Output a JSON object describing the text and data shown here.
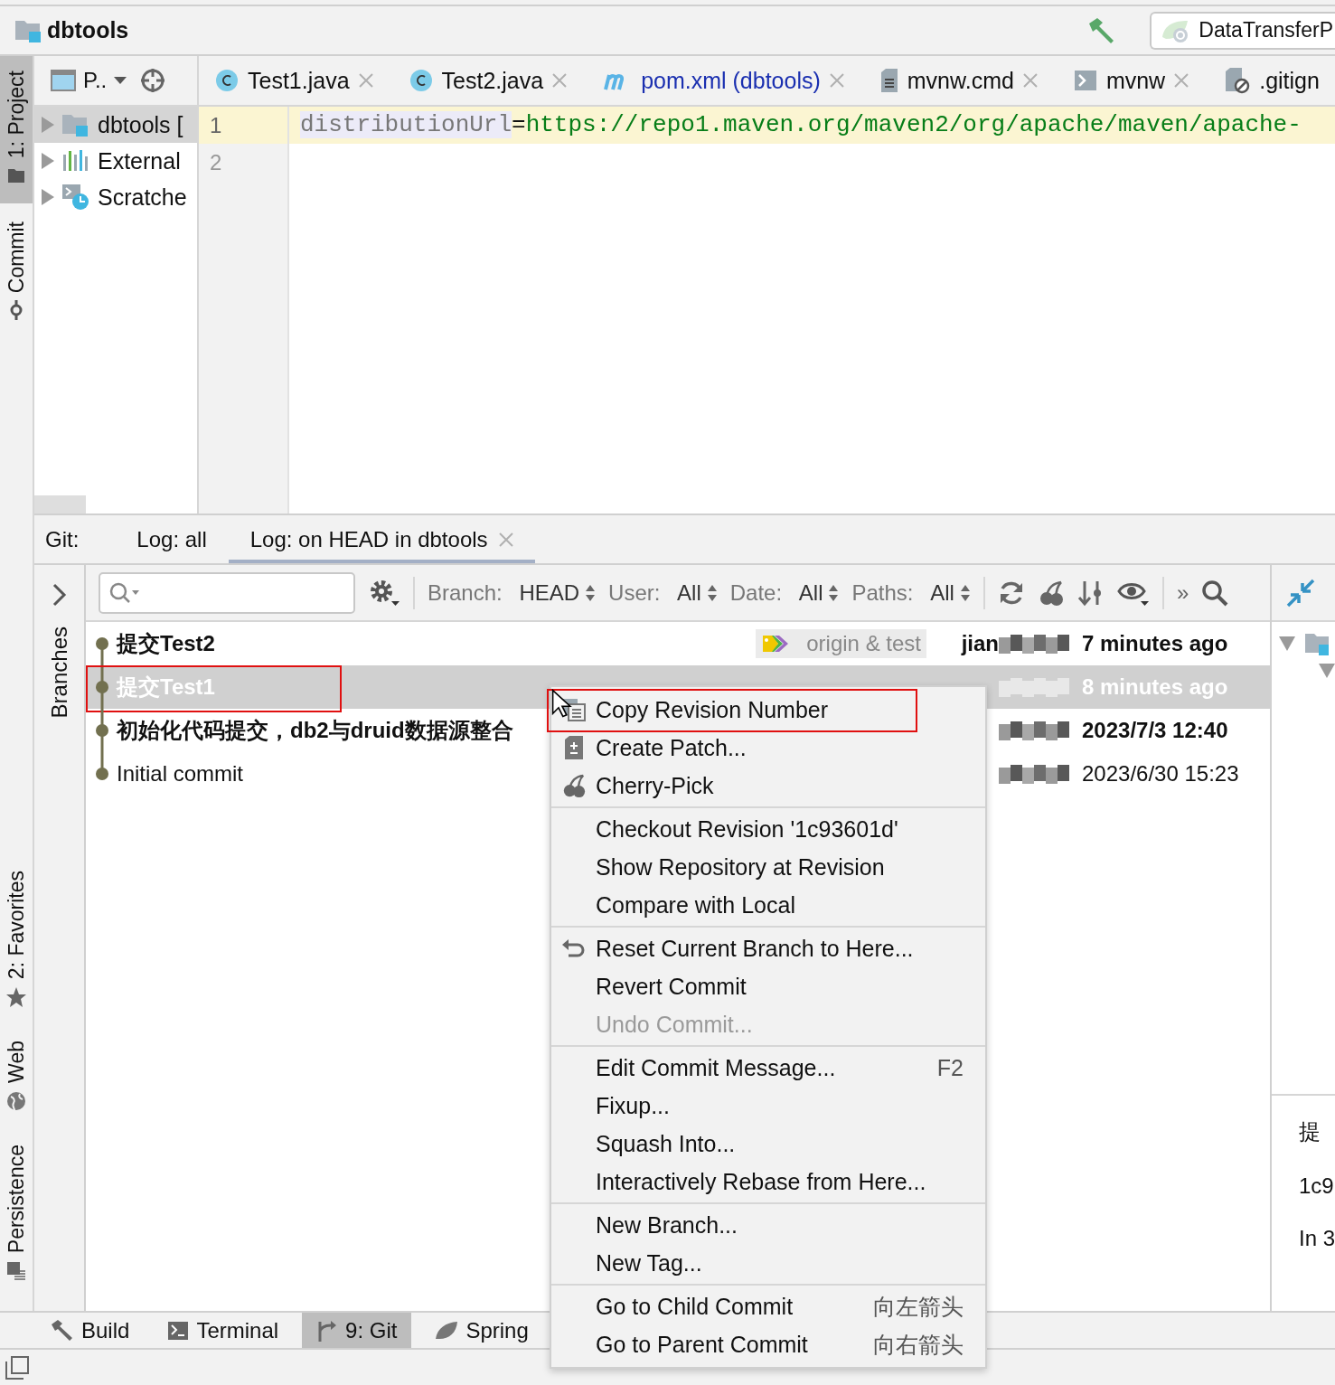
{
  "title_bar": {
    "project": "dbtools",
    "run_config": "DataTransferP"
  },
  "left_strip": {
    "top": [
      {
        "label": "1: Project",
        "kind": "folder",
        "selected": true
      },
      {
        "label": "Commit",
        "kind": "commit",
        "selected": false
      }
    ],
    "bottom": [
      {
        "label": "2: Favorites",
        "kind": "star",
        "selected": false
      },
      {
        "label": "Web",
        "kind": "globe",
        "selected": false
      },
      {
        "label": "Persistence",
        "kind": "persistence",
        "selected": false
      }
    ]
  },
  "project_panel": {
    "view": "P..",
    "tree": [
      {
        "label": "dbtools [",
        "kind": "module",
        "selected": true,
        "expanded": false
      },
      {
        "label": "External",
        "kind": "libraries",
        "selected": false,
        "expanded": false
      },
      {
        "label": "Scratche",
        "kind": "scratches",
        "selected": false,
        "expanded": false
      }
    ]
  },
  "editor": {
    "tabs": [
      {
        "label": "Test1.java",
        "kind": "class",
        "closable": true
      },
      {
        "label": "Test2.java",
        "kind": "class",
        "closable": true
      },
      {
        "label": "pom.xml (dbtools)",
        "kind": "maven",
        "closable": true
      },
      {
        "label": "mvnw.cmd",
        "kind": "text",
        "closable": true
      },
      {
        "label": "mvnw",
        "kind": "script",
        "closable": true
      },
      {
        "label": ".gitign",
        "kind": "ignored",
        "closable": false
      }
    ],
    "lines": [
      {
        "number": "1",
        "key": "distributionUrl",
        "sep": "=",
        "value": "https://repo1.maven.org/maven2/org/apache/maven/apache-",
        "current": true
      },
      {
        "number": "2",
        "current": false
      }
    ]
  },
  "git": {
    "label": "Git:",
    "tabs": [
      {
        "label": "Log: all",
        "selected": false,
        "closable": false
      },
      {
        "label": "Log: on HEAD in dbtools",
        "selected": true,
        "closable": true
      }
    ],
    "branches_label": "Branches",
    "filters": [
      {
        "label": "Branch:",
        "value": "HEAD"
      },
      {
        "label": "User:",
        "value": "All"
      },
      {
        "label": "Date:",
        "value": "All"
      },
      {
        "label": "Paths:",
        "value": "All"
      }
    ],
    "more": "»",
    "commits": [
      {
        "subject": "提交Test2",
        "bold": true,
        "selected": false,
        "highlighted": false,
        "refs": "origin & test",
        "author": "jian",
        "date": "7 minutes ago"
      },
      {
        "subject": "提交Test1",
        "bold": true,
        "selected": true,
        "highlighted": true,
        "date": "8 minutes ago"
      },
      {
        "subject": "初始化代码提交，db2与druid数据源整合",
        "bold": true,
        "selected": false,
        "highlighted": false,
        "date": "2023/7/3 12:40"
      },
      {
        "subject": "Initial commit",
        "bold": false,
        "selected": false,
        "highlighted": false,
        "date": "2023/6/30 15:23"
      }
    ],
    "details": [
      "提",
      "1c9",
      "In 3"
    ]
  },
  "menu": {
    "groups": [
      {
        "items": [
          {
            "label": "Copy Revision Number",
            "kind": "copy",
            "disabled": false,
            "highlighted": true
          },
          {
            "label": "Create Patch...",
            "kind": "patch",
            "disabled": false,
            "highlighted": false
          },
          {
            "label": "Cherry-Pick",
            "kind": "cherry",
            "disabled": false,
            "highlighted": false
          }
        ]
      },
      {
        "items": [
          {
            "label": "Checkout Revision '1c93601d'",
            "disabled": false,
            "highlighted": false
          },
          {
            "label": "Show Repository at Revision",
            "disabled": false,
            "highlighted": false
          },
          {
            "label": "Compare with Local",
            "disabled": false,
            "highlighted": false
          }
        ]
      },
      {
        "items": [
          {
            "label": "Reset Current Branch to Here...",
            "kind": "reset",
            "disabled": false,
            "highlighted": false
          },
          {
            "label": "Revert Commit",
            "disabled": false,
            "highlighted": false
          },
          {
            "label": "Undo Commit...",
            "disabled": true,
            "highlighted": false
          }
        ]
      },
      {
        "items": [
          {
            "label": "Edit Commit Message...",
            "shortcut": "F2",
            "disabled": false,
            "highlighted": false
          },
          {
            "label": "Fixup...",
            "disabled": false,
            "highlighted": false
          },
          {
            "label": "Squash Into...",
            "disabled": false,
            "highlighted": false
          },
          {
            "label": "Interactively Rebase from Here...",
            "disabled": false,
            "highlighted": false
          }
        ]
      },
      {
        "items": [
          {
            "label": "New Branch...",
            "disabled": false,
            "highlighted": false
          },
          {
            "label": "New Tag...",
            "disabled": false,
            "highlighted": false
          }
        ]
      },
      {
        "items": [
          {
            "label": "Go to Child Commit",
            "shortcut": "向左箭头",
            "disabled": false,
            "highlighted": false
          },
          {
            "label": "Go to Parent Commit",
            "shortcut": "向右箭头",
            "disabled": false,
            "highlighted": false
          }
        ]
      }
    ]
  },
  "bottom_bar": [
    {
      "label": "Build",
      "kind": "build",
      "selected": false
    },
    {
      "label": "Terminal",
      "kind": "terminal",
      "selected": false
    },
    {
      "label": "9: Git",
      "kind": "git",
      "selected": true
    },
    {
      "label": "Spring",
      "kind": "spring",
      "selected": false
    }
  ]
}
